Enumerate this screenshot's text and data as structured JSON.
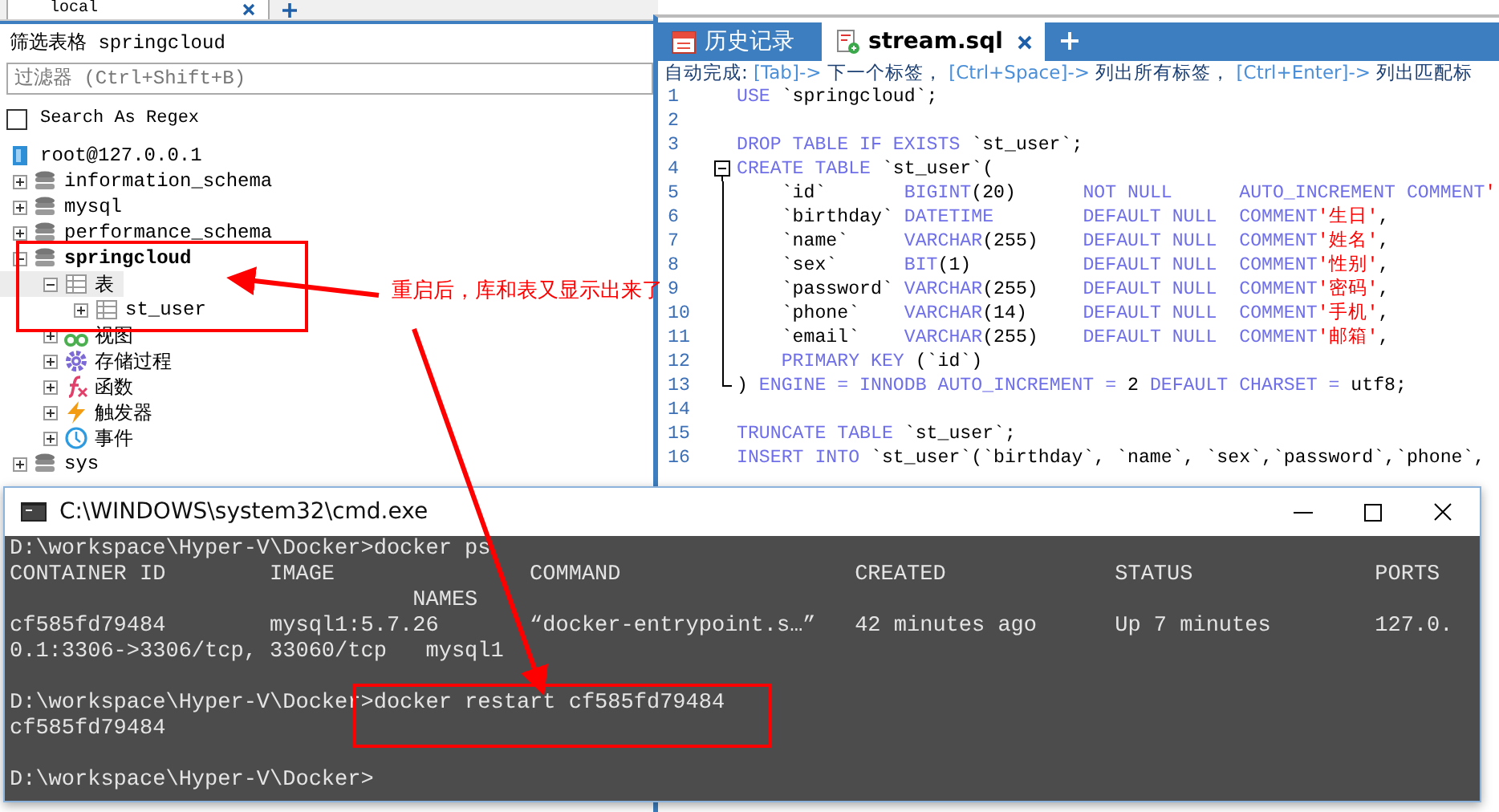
{
  "connection_tab": {
    "label": "local"
  },
  "filter": {
    "title": "筛选表格 springcloud",
    "placeholder": "过滤器 (Ctrl+Shift+B)",
    "regex_label": "Search As Regex",
    "regex_checked": false
  },
  "tree": [
    {
      "label": "root@127.0.0.1",
      "kind": "server",
      "selected": false,
      "active": false,
      "children": [
        {
          "label": "information_schema",
          "kind": "database",
          "expanded": false,
          "selected": false,
          "active": false
        },
        {
          "label": "mysql",
          "kind": "database",
          "expanded": false,
          "selected": false,
          "active": false
        },
        {
          "label": "performance_schema",
          "kind": "database",
          "expanded": false,
          "selected": false,
          "active": false
        },
        {
          "label": "springcloud",
          "kind": "database",
          "expanded": true,
          "selected": false,
          "active": true,
          "children": [
            {
              "label": "表",
              "kind": "tables",
              "expanded": true,
              "selected": true,
              "active": false,
              "children": [
                {
                  "label": "st_user",
                  "kind": "table",
                  "expanded": false,
                  "selected": false,
                  "active": false
                }
              ]
            },
            {
              "label": "视图",
              "kind": "views",
              "expanded": false,
              "selected": false,
              "active": false
            },
            {
              "label": "存储过程",
              "kind": "procedures",
              "expanded": false,
              "selected": false,
              "active": false
            },
            {
              "label": "函数",
              "kind": "functions",
              "expanded": false,
              "selected": false,
              "active": false
            },
            {
              "label": "触发器",
              "kind": "triggers",
              "expanded": false,
              "selected": false,
              "active": false
            },
            {
              "label": "事件",
              "kind": "events",
              "expanded": false,
              "selected": false,
              "active": false
            }
          ]
        },
        {
          "label": "sys",
          "kind": "database",
          "expanded": false,
          "selected": false,
          "active": false
        }
      ]
    }
  ],
  "editor": {
    "tabs": [
      {
        "label": "历史记录",
        "kind": "history",
        "selected": false,
        "closable": false
      },
      {
        "label": "stream.sql",
        "kind": "sql",
        "selected": true,
        "closable": true
      }
    ],
    "hint": [
      {
        "text": "自动完成: ",
        "kind": "label"
      },
      {
        "text": "[Tab]-> ",
        "kind": "key"
      },
      {
        "text": "下一个标签， ",
        "kind": "label"
      },
      {
        "text": "[Ctrl+Space]-> ",
        "kind": "key"
      },
      {
        "text": "列出所有标签， ",
        "kind": "label"
      },
      {
        "text": "[Ctrl+Enter]-> ",
        "kind": "key"
      },
      {
        "text": "列出匹配标",
        "kind": "label"
      }
    ],
    "lines": [
      {
        "number": "1",
        "segments": [
          {
            "text": "USE ",
            "kind": "kw"
          },
          {
            "text": "`springcloud`;",
            "kind": "txt"
          }
        ]
      },
      {
        "number": "2"
      },
      {
        "number": "3",
        "segments": [
          {
            "text": "DROP TABLE IF EXISTS ",
            "kind": "kw"
          },
          {
            "text": "`st_user`;",
            "kind": "txt"
          }
        ]
      },
      {
        "number": "4",
        "fold_expanded": true,
        "segments": [
          {
            "text": "CREATE TABLE ",
            "kind": "kw"
          },
          {
            "text": "`st_user`(",
            "kind": "txt"
          }
        ]
      },
      {
        "number": "5",
        "segments": [
          {
            "text": "    `id`       ",
            "kind": "txt"
          },
          {
            "text": "BIGINT",
            "kind": "kw"
          },
          {
            "text": "(20)      ",
            "kind": "txt"
          },
          {
            "text": "NOT NULL      AUTO_INCREMENT COMMENT",
            "kind": "kw"
          },
          {
            "text": "'",
            "kind": "str"
          }
        ]
      },
      {
        "number": "6",
        "segments": [
          {
            "text": "    `birthday` ",
            "kind": "txt"
          },
          {
            "text": "DATETIME        DEFAULT NULL  COMMENT",
            "kind": "kw"
          },
          {
            "text": "'生日'",
            "kind": "str"
          },
          {
            "text": ",",
            "kind": "txt"
          }
        ]
      },
      {
        "number": "7",
        "segments": [
          {
            "text": "    `name`     ",
            "kind": "txt"
          },
          {
            "text": "VARCHAR",
            "kind": "kw"
          },
          {
            "text": "(255)    ",
            "kind": "txt"
          },
          {
            "text": "DEFAULT NULL  COMMENT",
            "kind": "kw"
          },
          {
            "text": "'姓名'",
            "kind": "str"
          },
          {
            "text": ",",
            "kind": "txt"
          }
        ]
      },
      {
        "number": "8",
        "segments": [
          {
            "text": "    `sex`      ",
            "kind": "txt"
          },
          {
            "text": "BIT",
            "kind": "kw"
          },
          {
            "text": "(1)          ",
            "kind": "txt"
          },
          {
            "text": "DEFAULT NULL  COMMENT",
            "kind": "kw"
          },
          {
            "text": "'性别'",
            "kind": "str"
          },
          {
            "text": ",",
            "kind": "txt"
          }
        ]
      },
      {
        "number": "9",
        "segments": [
          {
            "text": "    `password` ",
            "kind": "txt"
          },
          {
            "text": "VARCHAR",
            "kind": "kw"
          },
          {
            "text": "(255)    ",
            "kind": "txt"
          },
          {
            "text": "DEFAULT NULL  COMMENT",
            "kind": "kw"
          },
          {
            "text": "'密码'",
            "kind": "str"
          },
          {
            "text": ",",
            "kind": "txt"
          }
        ]
      },
      {
        "number": "10",
        "segments": [
          {
            "text": "    `phone`    ",
            "kind": "txt"
          },
          {
            "text": "VARCHAR",
            "kind": "kw"
          },
          {
            "text": "(14)     ",
            "kind": "txt"
          },
          {
            "text": "DEFAULT NULL  COMMENT",
            "kind": "kw"
          },
          {
            "text": "'手机'",
            "kind": "str"
          },
          {
            "text": ",",
            "kind": "txt"
          }
        ]
      },
      {
        "number": "11",
        "segments": [
          {
            "text": "    `email`    ",
            "kind": "txt"
          },
          {
            "text": "VARCHAR",
            "kind": "kw"
          },
          {
            "text": "(255)    ",
            "kind": "txt"
          },
          {
            "text": "DEFAULT NULL  COMMENT",
            "kind": "kw"
          },
          {
            "text": "'邮箱'",
            "kind": "str"
          },
          {
            "text": ",",
            "kind": "txt"
          }
        ]
      },
      {
        "number": "12",
        "segments": [
          {
            "text": "    PRIMARY KEY ",
            "kind": "kw"
          },
          {
            "text": "(`id`)",
            "kind": "txt"
          }
        ]
      },
      {
        "number": "13",
        "fold_end": true,
        "segments": [
          {
            "text": ") ",
            "kind": "txt"
          },
          {
            "text": "ENGINE = INNODB AUTO_INCREMENT = ",
            "kind": "kw"
          },
          {
            "text": "2 ",
            "kind": "txt"
          },
          {
            "text": "DEFAULT CHARSET = ",
            "kind": "kw"
          },
          {
            "text": "utf8;",
            "kind": "txt"
          }
        ]
      },
      {
        "number": "14"
      },
      {
        "number": "15",
        "segments": [
          {
            "text": "TRUNCATE TABLE ",
            "kind": "kw"
          },
          {
            "text": "`st_user`;",
            "kind": "txt"
          }
        ]
      },
      {
        "number": "16",
        "segments": [
          {
            "text": "INSERT INTO ",
            "kind": "kw"
          },
          {
            "text": "`st_user`(`birthday`, `name`, `sex`,`password`,`phone`,",
            "kind": "txt"
          }
        ]
      }
    ]
  },
  "annotation": {
    "text": "重启后，库和表又显示出来了"
  },
  "terminal": {
    "title": "C:\\WINDOWS\\system32\\cmd.exe",
    "blocks": [
      {
        "lines": [
          "D:\\workspace\\Hyper-V\\Docker>docker ps",
          "CONTAINER ID        IMAGE               COMMAND                  CREATED             STATUS              PORTS",
          "                               NAMES",
          "cf585fd79484        mysql1:5.7.26       “docker-entrypoint.s…”   42 minutes ago      Up 7 minutes        127.0.",
          "0.1:3306->3306/tcp, 33060/tcp   mysql1"
        ]
      },
      {
        "lines": [
          "D:\\workspace\\Hyper-V\\Docker>docker restart cf585fd79484",
          "cf585fd79484"
        ]
      },
      {
        "lines": [
          "D:\\workspace\\Hyper-V\\Docker>"
        ]
      }
    ]
  }
}
